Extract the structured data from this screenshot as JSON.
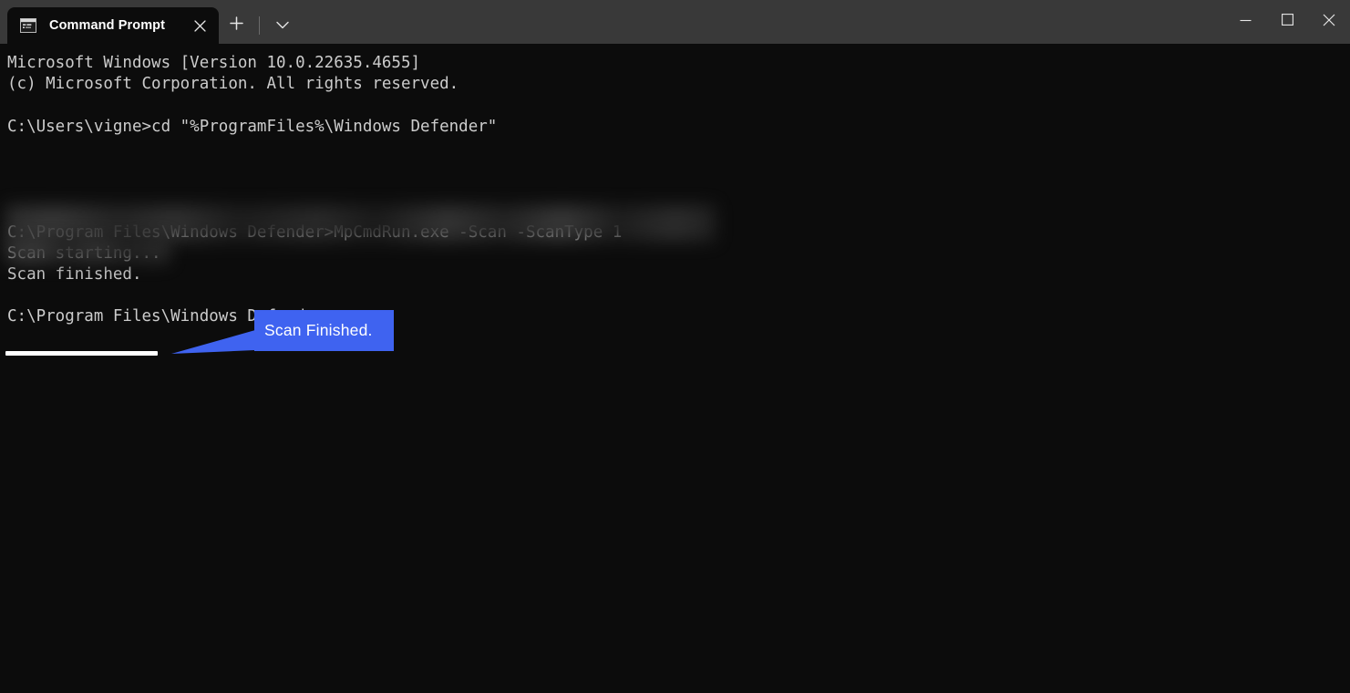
{
  "window": {
    "title": "Command Prompt",
    "titlebar_color": "#393939",
    "body_color": "#0c0c0c",
    "text_color": "#cccccc"
  },
  "tabstrip": {
    "tabs": [
      {
        "label": "Command Prompt",
        "icon": "console-icon",
        "close_icon": "close-icon",
        "active": true
      }
    ],
    "new_tab_icon": "plus-icon",
    "dropdown_icon": "chevron-down-icon"
  },
  "caption": {
    "minimize_icon": "minimize-icon",
    "maximize_icon": "maximize-icon",
    "close_icon": "close-icon"
  },
  "terminal": {
    "lines": [
      "Microsoft Windows [Version 10.0.22635.4655]",
      "(c) Microsoft Corporation. All rights reserved.",
      "",
      "C:\\Users\\vigne>cd \"%ProgramFiles%\\Windows Defender\"",
      "",
      "",
      "",
      "",
      "C:\\Program Files\\Windows Defender>MpCmdRun.exe -Scan -ScanType 1",
      "Scan starting...",
      "Scan finished.",
      "",
      "C:\\Program Files\\Windows Defender>"
    ],
    "text": "Microsoft Windows [Version 10.0.22635.4655]\n(c) Microsoft Corporation. All rights reserved.\n\nC:\\Users\\vigne>cd \"%ProgramFiles%\\Windows Defender\"\n\n\n\n\nC:\\Program Files\\Windows Defender>MpCmdRun.exe -Scan -ScanType 1\nScan starting...\nScan finished.\n\nC:\\Program Files\\Windows Defender>",
    "redacted_regions": 2
  },
  "annotation": {
    "label": "Scan Finished.",
    "callout_color": "#3f63f0",
    "underline_color": "#ffffff",
    "underlined_text": "Scan finished."
  }
}
